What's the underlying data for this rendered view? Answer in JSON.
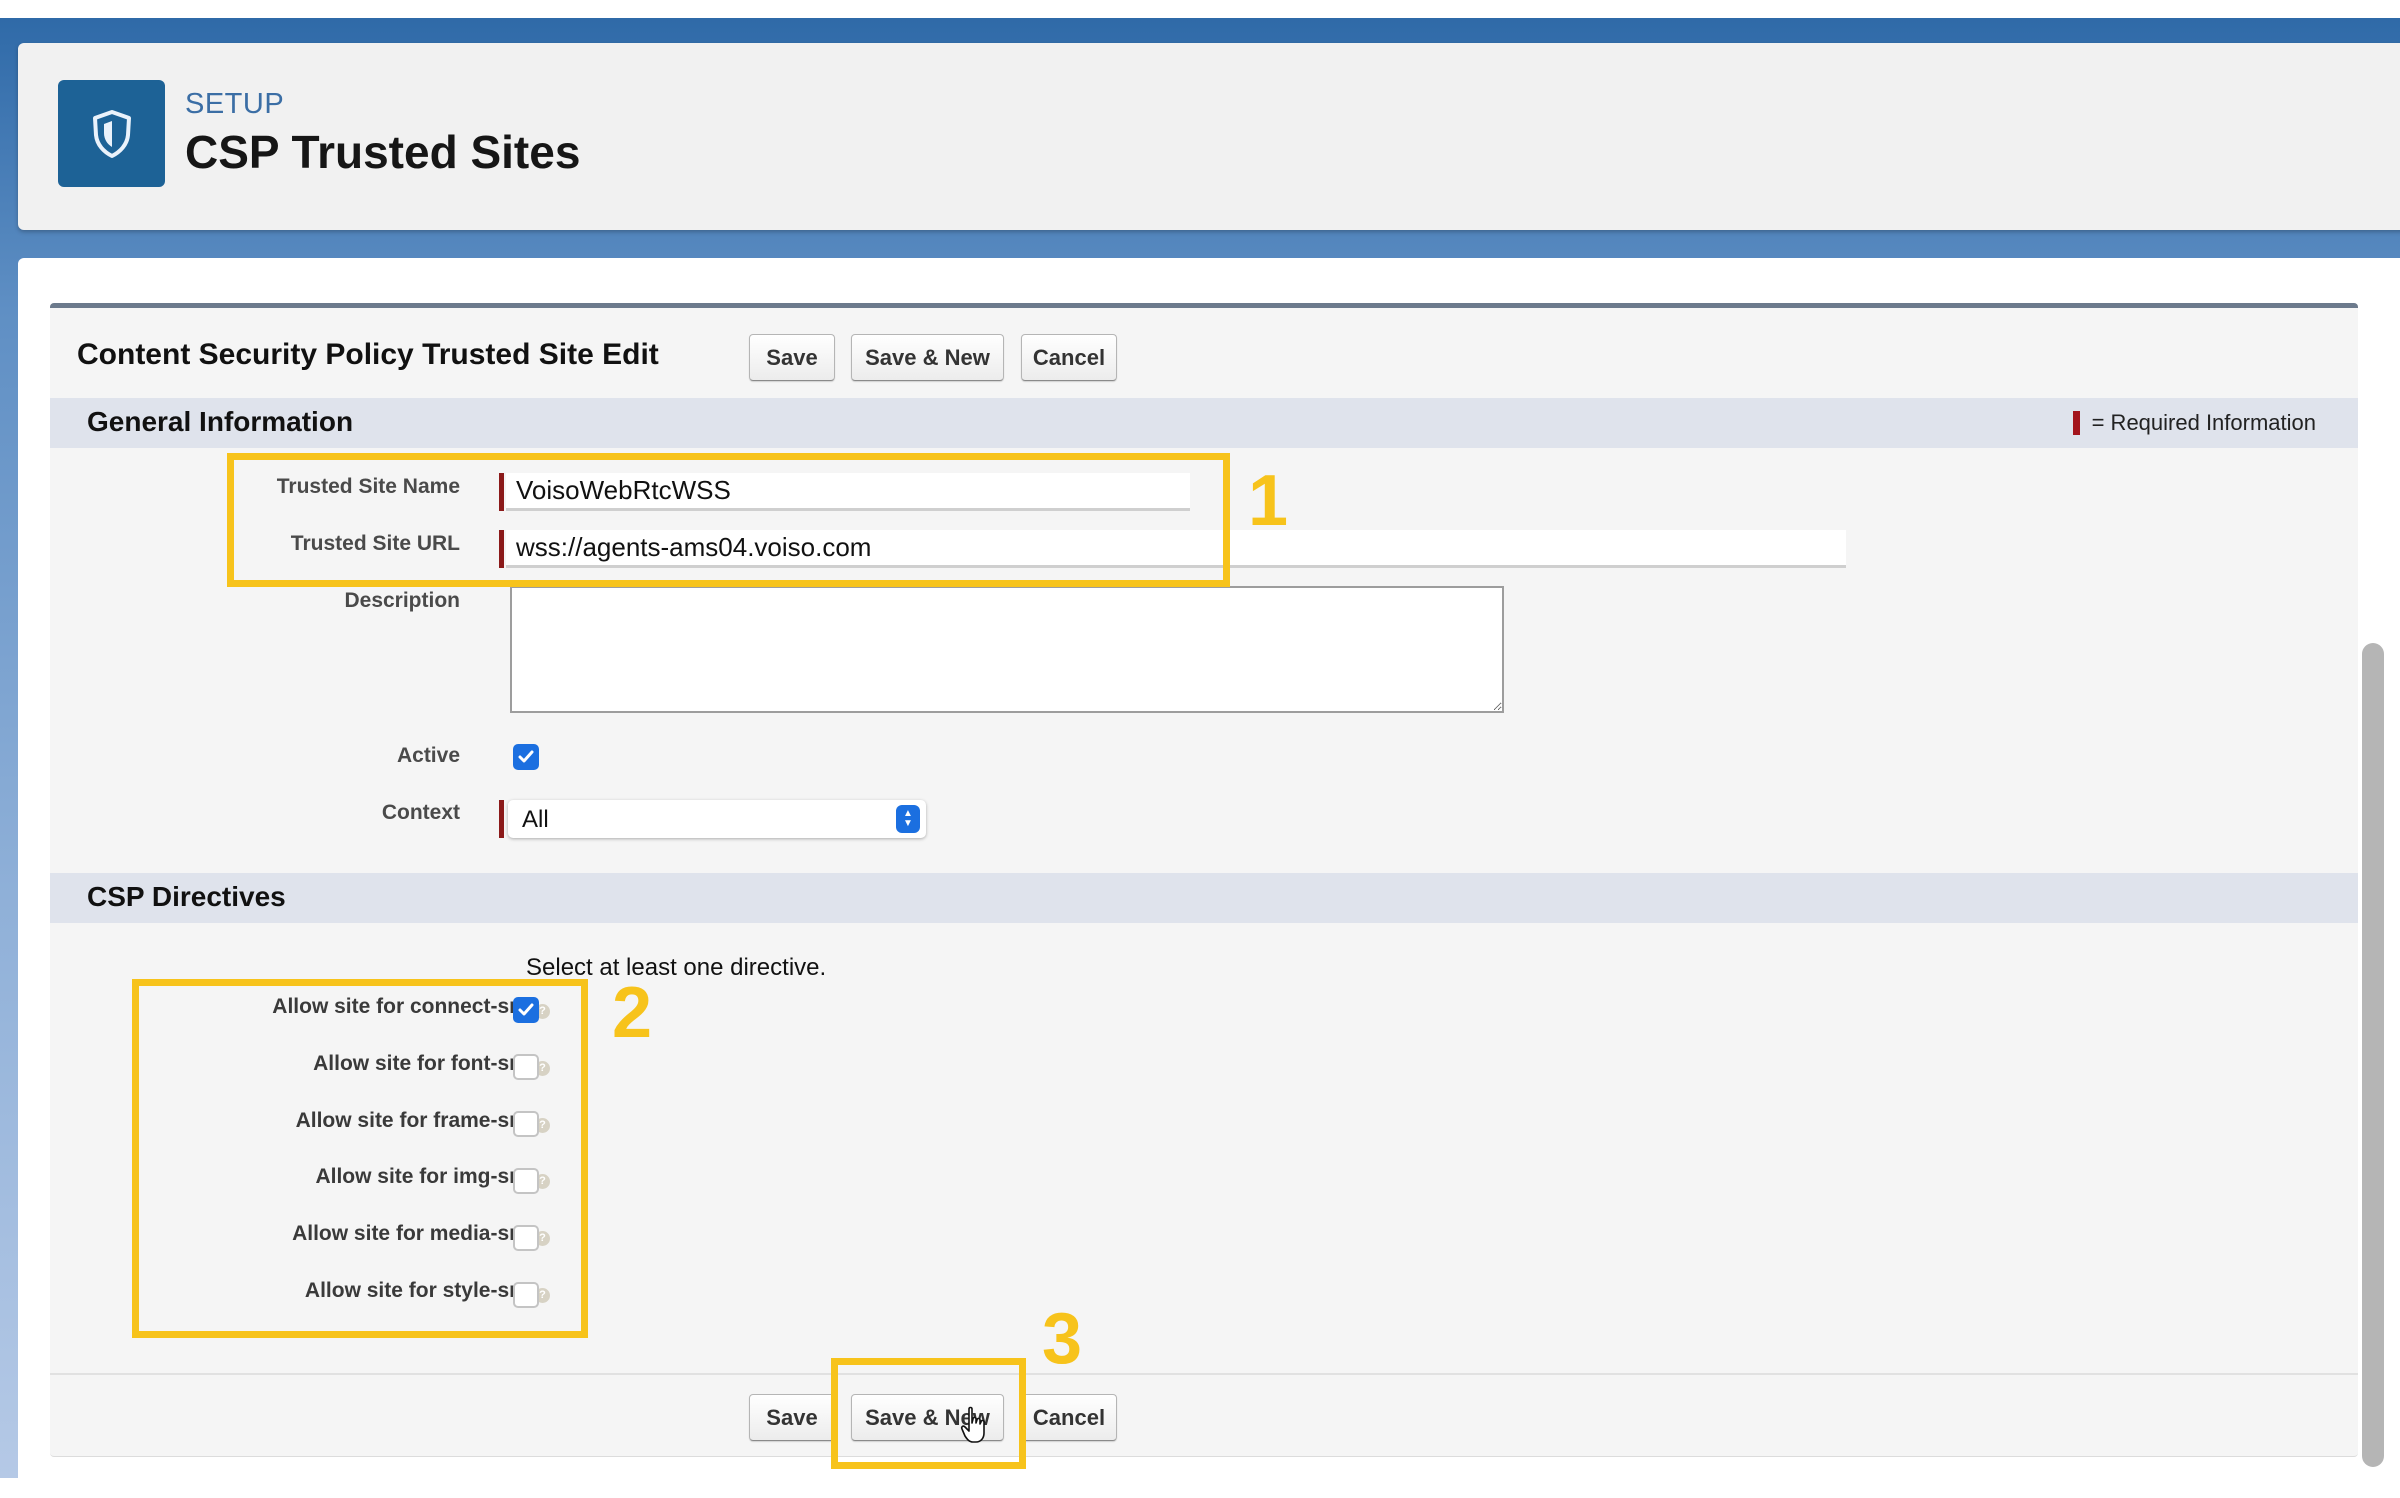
{
  "header": {
    "breadcrumb": "SETUP",
    "title": "CSP Trusted Sites",
    "icon": "shield-icon",
    "icon_color": "#1d6296"
  },
  "form": {
    "title": "Content Security Policy Trusted Site Edit",
    "buttons": {
      "save": "Save",
      "save_new": "Save & New",
      "cancel": "Cancel"
    },
    "general_section": {
      "title": "General Information",
      "required_legend": "= Required Information",
      "fields": {
        "name_label": "Trusted Site Name",
        "name_value": "VoisoWebRtcWSS",
        "url_label": "Trusted Site URL",
        "url_value": "wss://agents-ams04.voiso.com",
        "description_label": "Description",
        "description_value": "",
        "active_label": "Active",
        "active_checked": true,
        "context_label": "Context",
        "context_value": "All"
      }
    },
    "csp_section": {
      "title": "CSP Directives",
      "hint": "Select at least one directive.",
      "directives": [
        {
          "label": "Allow site for connect-src",
          "checked": true
        },
        {
          "label": "Allow site for font-src",
          "checked": false
        },
        {
          "label": "Allow site for frame-src",
          "checked": false
        },
        {
          "label": "Allow site for img-src",
          "checked": false
        },
        {
          "label": "Allow site for media-src",
          "checked": false
        },
        {
          "label": "Allow site for style-src",
          "checked": false
        }
      ]
    }
  },
  "annotations": {
    "step1": "1",
    "step2": "2",
    "step3": "3",
    "highlight_color": "#f7c31b"
  },
  "colors": {
    "checkbox_accent": "#1b6fe0",
    "required_marker": "#a3141c"
  }
}
